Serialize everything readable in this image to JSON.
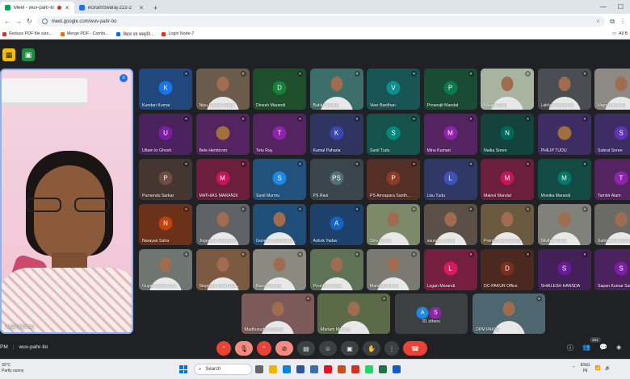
{
  "browser": {
    "tabs": [
      {
        "label": "Meet - wuv-pahr-tio",
        "active": true
      },
      {
        "label": "eGramSwaraj-222-2",
        "active": false
      }
    ],
    "url": "meet.google.com/wuv-pahr-tio",
    "bookmarks": [
      "Reduce PDF file size...",
      "Merge PDF - Combi...",
      "बिहार एवं संस्कृति...",
      "Login Node-7"
    ],
    "all_bookmarks": "All B"
  },
  "self_view": {
    "name": "Anjali Murmu"
  },
  "participants": [
    {
      "name": "Kundan Kumar",
      "initial": "K",
      "color": "#1a73e8",
      "row": 0,
      "col": 0
    },
    {
      "name": "Nipu Kumar Sardar",
      "initial": "",
      "color": "#6b5b4b",
      "row": 0,
      "col": 1,
      "photo": true
    },
    {
      "name": "Dinesh Marandi",
      "initial": "D",
      "color": "#188038",
      "row": 0,
      "col": 2
    },
    {
      "name": "Bablu Hansda",
      "initial": "",
      "color": "#3c6e6a",
      "row": 0,
      "col": 3,
      "photo": true
    },
    {
      "name": "Veer Bardhan",
      "initial": "V",
      "color": "#0b8f8f",
      "row": 0,
      "col": 4
    },
    {
      "name": "Prosenjit Mandal",
      "initial": "P",
      "color": "#0d7a4a",
      "row": 0,
      "col": 5
    },
    {
      "name": "Vikash Dond",
      "initial": "",
      "color": "#a8b4a0",
      "row": 0,
      "col": 6,
      "photo": true
    },
    {
      "name": "Lakhan Hembrom",
      "initial": "",
      "color": "#4a4d52",
      "row": 0,
      "col": 7,
      "photo": true
    },
    {
      "name": "Hajrat Umar Ali",
      "initial": "",
      "color": "#8d8a86",
      "row": 0,
      "col": 8,
      "photo": true
    },
    {
      "name": "Uttam kr Ghosh",
      "initial": "U",
      "color": "#7b1fa2",
      "row": 1,
      "col": 0
    },
    {
      "name": "Bele Hembrom",
      "initial": "",
      "color": "#8e24aa",
      "row": 1,
      "col": 1
    },
    {
      "name": "Tetu Ray",
      "initial": "T",
      "color": "#8e24aa",
      "row": 1,
      "col": 2
    },
    {
      "name": "Kamal Paharia",
      "initial": "K",
      "color": "#3949ab",
      "row": 1,
      "col": 3
    },
    {
      "name": "Sunil Tudu",
      "initial": "S",
      "color": "#00897b",
      "row": 1,
      "col": 4
    },
    {
      "name": "Minu Kumari",
      "initial": "M",
      "color": "#8e24aa",
      "row": 1,
      "col": 5
    },
    {
      "name": "Naika Soren",
      "initial": "N",
      "color": "#00695c",
      "row": 1,
      "col": 6
    },
    {
      "name": "PHILIP TUDU",
      "initial": "",
      "color": "#5e35b1",
      "row": 1,
      "col": 7
    },
    {
      "name": "Subrat Soren",
      "initial": "S",
      "color": "#5e35b1",
      "row": 1,
      "col": 8
    },
    {
      "name": "Purnendu Sarkar",
      "initial": "P",
      "color": "#6d4c41",
      "row": 2,
      "col": 0
    },
    {
      "name": "MATHIAS MARANDI",
      "initial": "M",
      "color": "#c2185b",
      "row": 2,
      "col": 1
    },
    {
      "name": "Sunil Murmu",
      "initial": "S",
      "color": "#1e88e5",
      "row": 2,
      "col": 2
    },
    {
      "name": "PS Ravi",
      "initial": "PS",
      "color": "#546e7a",
      "row": 2,
      "col": 3
    },
    {
      "name": "PS Amrapara Santh...",
      "initial": "P",
      "color": "#8d3b28",
      "row": 2,
      "col": 4
    },
    {
      "name": "Lisu Tudu",
      "initial": "L",
      "color": "#3f51b5",
      "row": 2,
      "col": 5
    },
    {
      "name": "Mainul Mandal",
      "initial": "M",
      "color": "#c2185b",
      "row": 2,
      "col": 6
    },
    {
      "name": "Monika Marandi",
      "initial": "M",
      "color": "#00796b",
      "row": 2,
      "col": 7
    },
    {
      "name": "Tambir Alam",
      "initial": "T",
      "color": "#8e24aa",
      "row": 2,
      "col": 8
    },
    {
      "name": "Narayan Saha",
      "initial": "N",
      "color": "#c2410c",
      "row": 3,
      "col": 0
    },
    {
      "name": "Jogeswar Hembrom",
      "initial": "",
      "color": "#5f6368",
      "row": 3,
      "col": 1,
      "photo": true
    },
    {
      "name": "Ganesh Chandra D...",
      "initial": "",
      "color": "#1f4e79",
      "row": 3,
      "col": 2,
      "photo": true
    },
    {
      "name": "Ashok Yadav",
      "initial": "A",
      "color": "#1565c0",
      "row": 3,
      "col": 3
    },
    {
      "name": "Shiv Kumar",
      "initial": "",
      "color": "#7c8a6a",
      "row": 3,
      "col": 4,
      "photo": true
    },
    {
      "name": "saurabh suman",
      "initial": "",
      "color": "#5a5048",
      "row": 3,
      "col": 5,
      "photo": true
    },
    {
      "name": "Premchand Hansda",
      "initial": "",
      "color": "#6a5a40",
      "row": 3,
      "col": 6,
      "photo": true
    },
    {
      "name": "Silvihan Kisku",
      "initial": "",
      "color": "#80827a",
      "row": 3,
      "col": 7,
      "photo": true
    },
    {
      "name": "Salmani Hembrom",
      "initial": "",
      "color": "#6b6b66",
      "row": 3,
      "col": 8,
      "photo": true
    },
    {
      "name": "Gupin Murmu Offi...",
      "initial": "",
      "color": "#6f7570",
      "row": 4,
      "col": 0,
      "photo": true
    },
    {
      "name": "Stephanmurmu Mur...",
      "initial": "",
      "color": "#7a5a40",
      "row": 4,
      "col": 1,
      "photo": true
    },
    {
      "name": "Ranu Hansda",
      "initial": "",
      "color": "#8a8a80",
      "row": 4,
      "col": 2,
      "photo": true
    },
    {
      "name": "Prombil hansda",
      "initial": "",
      "color": "#5e7256",
      "row": 4,
      "col": 3,
      "photo": true
    },
    {
      "name": "Marshal Murmu",
      "initial": "",
      "color": "#7b7a72",
      "row": 4,
      "col": 4,
      "photo": true
    },
    {
      "name": "Logan Marandi",
      "initial": "L",
      "color": "#d81b60",
      "row": 4,
      "col": 5
    },
    {
      "name": "DC-PAKUR Office",
      "initial": "D",
      "color": "#7a2e1d",
      "row": 4,
      "col": 6
    },
    {
      "name": "SHAILESH HANSDA",
      "initial": "S",
      "color": "#6a1b9a",
      "row": 4,
      "col": 7
    },
    {
      "name": "Sapan Kumar Sah",
      "initial": "S",
      "color": "#7b1fa2",
      "row": 4,
      "col": 8
    }
  ],
  "bottom_row": [
    {
      "name": "Madhusudan Mandal",
      "photo": true
    },
    {
      "name": "Mariam Marandi",
      "photo": true
    },
    {
      "name": "81 others",
      "others": true
    },
    {
      "name": "DPM PAKUR",
      "photo": true
    }
  ],
  "meeting": {
    "time": "PM",
    "code": "wuv-pahr-tio",
    "participant_count": "131"
  },
  "taskbar": {
    "weather_temp": "30°C",
    "weather_desc": "Partly sunny",
    "search_label": "Search",
    "lang_top": "ENG",
    "lang_bottom": "IN"
  },
  "colors": {
    "meet_bg": "#202124",
    "end_call": "#ea4335",
    "self_border": "#8ab4f8"
  }
}
